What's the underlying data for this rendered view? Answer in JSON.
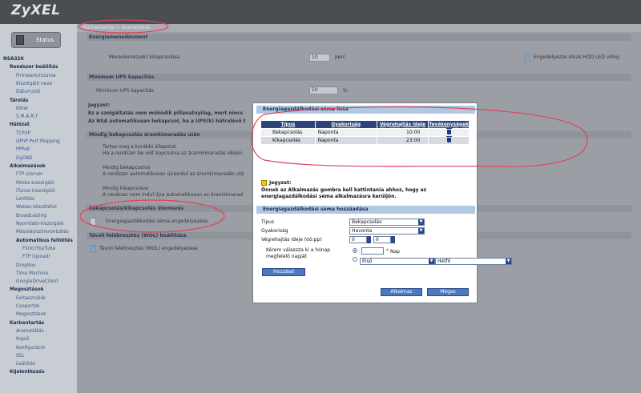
{
  "app": {
    "logo": "ZyXEL",
    "status_label": "Status"
  },
  "breadcrumb": "Karbantartás > Áramellátás",
  "sidebar": {
    "items": [
      {
        "label": "NSA320"
      },
      {
        "label": "Rendszer beállítás"
      },
      {
        "label": "Firmware/rszama"
      },
      {
        "label": "Kiszolgáló neve"
      },
      {
        "label": "Dátum/Idő"
      },
      {
        "label": "Tárolás"
      },
      {
        "label": "Kötet"
      },
      {
        "label": "S.M.A.R.T"
      },
      {
        "label": "Hálózat"
      },
      {
        "label": "TCP/IP"
      },
      {
        "label": "UPnP Port Mapping"
      },
      {
        "label": "PPPoE"
      },
      {
        "label": "DyDNS"
      },
      {
        "label": "Alkalmazások"
      },
      {
        "label": "FTP szerver"
      },
      {
        "label": "Média kiszolgáló"
      },
      {
        "label": "iTunes kiszolgáló"
      },
      {
        "label": "Letöltés"
      },
      {
        "label": "Webes közzététel"
      },
      {
        "label": "Broadcasting"
      },
      {
        "label": "Nyomtató-kiszolgáló"
      },
      {
        "label": "Másolás/szinkronizálás"
      },
      {
        "label": "Automatikus feltöltés"
      },
      {
        "label": "Flickr/YouTube"
      },
      {
        "label": "FTP Uploadr"
      },
      {
        "label": "Dropbox"
      },
      {
        "label": "Time Machine"
      },
      {
        "label": "GoogleDriveClient"
      },
      {
        "label": "Megosztások"
      },
      {
        "label": "Felhasználók"
      },
      {
        "label": "Csoportok"
      },
      {
        "label": "Megosztások"
      },
      {
        "label": "Karbantartás"
      },
      {
        "label": "Áramellátás"
      },
      {
        "label": "Napló"
      },
      {
        "label": "Konfiguráció"
      },
      {
        "label": "SSL"
      },
      {
        "label": "Leállítás"
      },
      {
        "label": "Kijelentkezés"
      }
    ]
  },
  "background": {
    "sec_power": "Energiamenedzsment",
    "hdd_label": "Merevlemez(ek) kikapcsolása",
    "hdd_value": "10",
    "hdd_unit": "perc",
    "led_label": "Engedélyezze Alvás HDD LED villog",
    "sec_ups": "Minimum UPS kapacitás",
    "ups_label": "Minimum UPS kapacitás",
    "ups_value": "50",
    "ups_unit": "%",
    "note_title": "Jegyzet:",
    "note_1": "Ez a szolgáltatás nem működik pillanatnyilag, mert nincs",
    "note_2": "Az NSA automatikusan bekapcsol, ha a UPS(k) hátralévő t",
    "sec_restore": "Mindig bekapcsolás áramkimaradás után",
    "opt1": "Tartsa meg a korábbi állapotot",
    "opt1_desc": "Ha a rendszer be volt kapcsolva az áramkimaradás idején,",
    "opt2": "Mindig bekapcsolva",
    "opt2_desc": "A rendszer automatikusan újraindul az áramkimaradás utá",
    "opt3": "Mindig kikapcsolva",
    "opt3_desc": "A rendszer nem indul újra automatikusan az áramkimarad",
    "sec_sched": "Bekapcsolás/kikapcsolás ütemezés",
    "sched_label": "Energiagazdálkodási séma engedélyezése",
    "sec_wol": "Távoli felébresztés (WOL) beállítása",
    "wol_label": "Távoli felébresztés (WOL) engedélyezése"
  },
  "modal": {
    "list_title": "Energiagazdálkodási séma lista",
    "columns": [
      "Típus",
      "Gyakoriság",
      "Végrehajtás ideje",
      "Tevékenységek"
    ],
    "rows": [
      {
        "type": "Bekapcsolás",
        "freq": "Naponta",
        "time": "10:00"
      },
      {
        "type": "Kikapcsolás",
        "freq": "Naponta",
        "time": "23:00"
      }
    ],
    "note_title": "Jegyzet:",
    "note_text": "Önnek az Alkalmazás gombra kell kattintania ahhoz, hogy az energiagazdálkodási séma alkalmazásra kerüljön.",
    "add_title": "Energiagazdálkodási séma hozzáadása",
    "type_label": "Típus",
    "type_value": "Bekapcsolás",
    "freq_label": "Gyakoriság",
    "freq_value": "Havonta",
    "time_label": "Végrehajtás ideje (óó:pp)",
    "time_h": "0",
    "time_m": "0",
    "day_prompt_1": "Kérem válassza ki a hónap",
    "day_prompt_2": "megfelelő napját",
    "day_value": "",
    "day_unit": "Nap",
    "required_mark": "*",
    "week_ordinal": "Első",
    "weekday": "Hétfő",
    "add_button": "Hozzáad",
    "apply_button": "Alkalmaz",
    "cancel_button": "Mégse"
  }
}
